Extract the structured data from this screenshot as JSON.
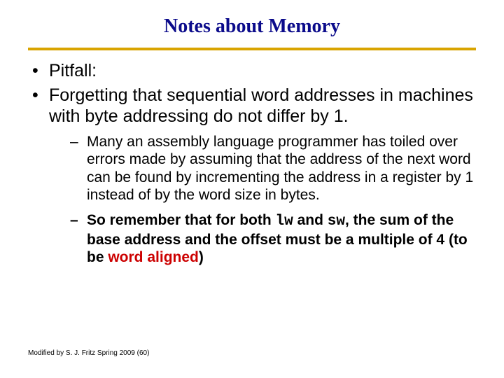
{
  "title": "Notes about Memory",
  "bullets": {
    "b1": "Pitfall:",
    "b2": "Forgetting that sequential word addresses in machines with byte addressing do not differ by 1.",
    "sub1": "Many an assembly language programmer has toiled over errors made by assuming that the address of the next word can be found by incrementing the address in a register by 1 instead of by the word size in bytes.",
    "sub2_a": "So remember that for both ",
    "sub2_lw": "lw",
    "sub2_b": " and ",
    "sub2_sw": "sw",
    "sub2_c": ", the sum of the base address and the offset must be a multiple of 4  (to be ",
    "sub2_wa": "word aligned",
    "sub2_d": ")"
  },
  "footer": "Modified by S. J. Fritz  Spring 2009 (60)"
}
